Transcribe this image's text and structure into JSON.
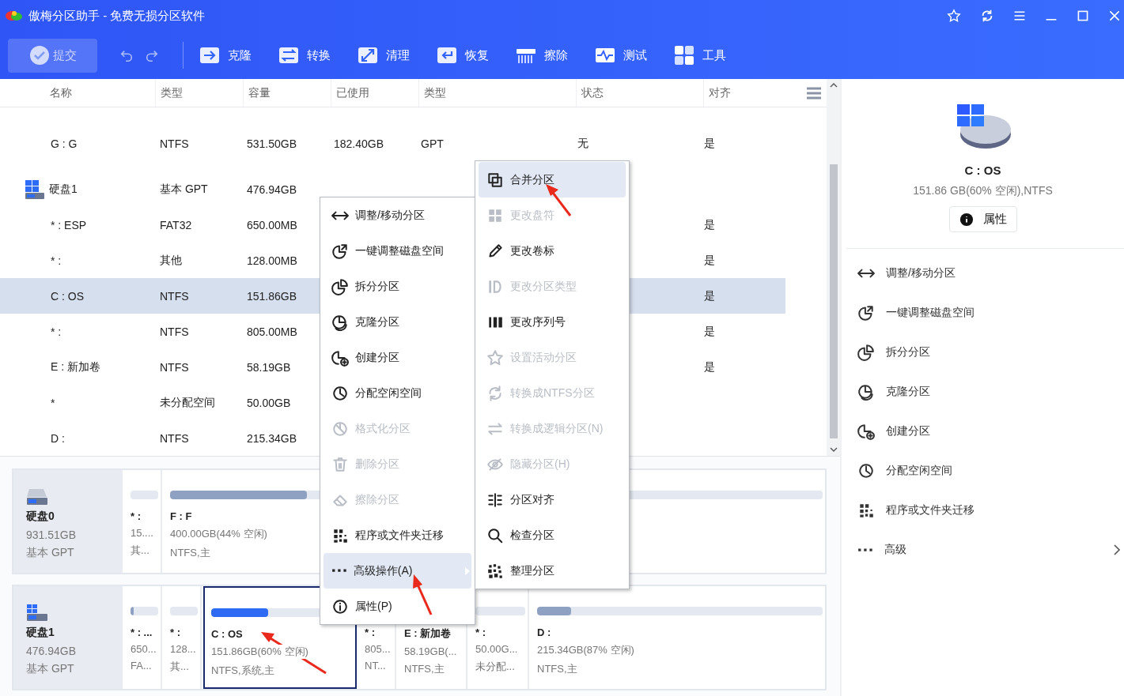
{
  "window": {
    "title": "傲梅分区助手 - 免费无损分区软件"
  },
  "toolbar": {
    "commit": {
      "label": "提交",
      "disabled": true
    },
    "tools": [
      {
        "label": "克隆"
      },
      {
        "label": "转换"
      },
      {
        "label": "清理"
      },
      {
        "label": "恢复"
      },
      {
        "label": "擦除"
      },
      {
        "label": "测试"
      },
      {
        "label": "工具"
      }
    ]
  },
  "table": {
    "columns": [
      "名称",
      "类型",
      "容量",
      "已使用",
      "类型",
      "状态",
      "对齐"
    ],
    "rows": [
      {
        "kind": "partition",
        "name": "G : G",
        "type": "NTFS",
        "capacity": "531.50GB",
        "used": "182.40GB",
        "part_type": "GPT",
        "status": "无",
        "aligned": "是",
        "selected": false
      },
      {
        "kind": "disk",
        "name": "硬盘1",
        "type": "基本 GPT",
        "capacity": "476.94GB",
        "selected": false
      },
      {
        "kind": "partition",
        "name": "* : ESP",
        "type": "FAT32",
        "capacity": "650.00MB",
        "aligned": "是",
        "selected": false
      },
      {
        "kind": "partition",
        "name": "* :",
        "type": "其他",
        "capacity": "128.00MB",
        "aligned": "是",
        "selected": false
      },
      {
        "kind": "partition",
        "name": "C : OS",
        "type": "NTFS",
        "capacity": "151.86GB",
        "aligned": "是",
        "selected": true
      },
      {
        "kind": "partition",
        "name": "* :",
        "type": "NTFS",
        "capacity": "805.00MB",
        "aligned": "是",
        "selected": false
      },
      {
        "kind": "partition",
        "name": "E : 新加卷",
        "type": "NTFS",
        "capacity": "58.19GB",
        "aligned": "是",
        "selected": false
      },
      {
        "kind": "partition",
        "name": "*",
        "type": "未分配空间",
        "capacity": "50.00GB",
        "selected": false
      },
      {
        "kind": "partition",
        "name": "D :",
        "type": "NTFS",
        "capacity": "215.34GB",
        "selected": false
      }
    ]
  },
  "disk_map": [
    {
      "name": "硬盘0",
      "size": "931.51GB",
      "style": "基本 GPT",
      "system": false,
      "partitions": [
        {
          "label": "* :",
          "size": "15....",
          "fs": "其...",
          "selected": false
        },
        {
          "label": "F : F",
          "size": "400.00GB(44% 空闲)",
          "fs": "NTFS,主",
          "level": 0.21,
          "selected": false
        }
      ]
    },
    {
      "name": "硬盘1",
      "size": "476.94GB",
      "style": "基本 GPT",
      "system": true,
      "partitions": [
        {
          "label": "* : ...",
          "size": "650...",
          "fs": "FA...",
          "level": 0.12,
          "selected": false
        },
        {
          "label": "* :",
          "size": "128...",
          "fs": "其...",
          "selected": false
        },
        {
          "label": "C : OS",
          "size": "151.86GB(60% 空闲)",
          "fs": "NTFS,系统,主",
          "level": 0.4,
          "selected": true
        },
        {
          "label": "* :",
          "size": "805...",
          "fs": "NT...",
          "selected": false
        },
        {
          "label": "E : 新加卷",
          "size": "58.19GB(...",
          "fs": "NTFS,主",
          "selected": false
        },
        {
          "label": "* :",
          "size": "50.00G...",
          "fs": "未分配...",
          "selected": false
        },
        {
          "label": "D :",
          "size": "215.34GB(87% 空闲)",
          "fs": "NTFS,主",
          "level": 0.12,
          "selected": false
        }
      ]
    }
  ],
  "context_menu": {
    "items": [
      {
        "label": "调整/移动分区",
        "disabled": false,
        "selected": false,
        "submenu": false
      },
      {
        "label": "一键调整磁盘空间",
        "disabled": false,
        "selected": false,
        "submenu": false
      },
      {
        "label": "拆分分区",
        "disabled": false,
        "selected": false,
        "submenu": false
      },
      {
        "label": "克隆分区",
        "disabled": false,
        "selected": false,
        "submenu": false
      },
      {
        "label": "创建分区",
        "disabled": false,
        "selected": false,
        "submenu": false
      },
      {
        "label": "分配空闲空间",
        "disabled": false,
        "selected": false,
        "submenu": false
      },
      {
        "label": "格式化分区",
        "disabled": true,
        "selected": false,
        "submenu": false
      },
      {
        "label": "删除分区",
        "disabled": true,
        "selected": false,
        "submenu": false
      },
      {
        "label": "擦除分区",
        "disabled": true,
        "selected": false,
        "submenu": false
      },
      {
        "label": "程序或文件夹迁移",
        "disabled": false,
        "selected": false,
        "submenu": false
      },
      {
        "label": "高级操作(A)",
        "disabled": false,
        "selected": true,
        "submenu": true
      },
      {
        "label": "属性(P)",
        "disabled": false,
        "selected": false,
        "submenu": false
      }
    ]
  },
  "submenu": {
    "items": [
      {
        "label": "合并分区",
        "disabled": false,
        "selected": true
      },
      {
        "label": "更改盘符",
        "disabled": true,
        "selected": false
      },
      {
        "label": "更改卷标",
        "disabled": false,
        "selected": false
      },
      {
        "label": "更改分区类型",
        "disabled": true,
        "selected": false
      },
      {
        "label": "更改序列号",
        "disabled": false,
        "selected": false
      },
      {
        "label": "设置活动分区",
        "disabled": true,
        "selected": false
      },
      {
        "label": "转换成NTFS分区",
        "disabled": true,
        "selected": false
      },
      {
        "label": "转换成逻辑分区(N)",
        "disabled": true,
        "selected": false
      },
      {
        "label": "隐藏分区(H)",
        "disabled": true,
        "selected": false
      },
      {
        "label": "分区对齐",
        "disabled": false,
        "selected": false
      },
      {
        "label": "检查分区",
        "disabled": false,
        "selected": false
      },
      {
        "label": "整理分区",
        "disabled": false,
        "selected": false
      }
    ]
  },
  "details": {
    "title": "C : OS",
    "info": "151.86 GB(60% 空闲),NTFS",
    "button": "属性",
    "actions": [
      {
        "label": "调整/移动分区",
        "submenu": false
      },
      {
        "label": "一键调整磁盘空间",
        "submenu": false
      },
      {
        "label": "拆分分区",
        "submenu": false
      },
      {
        "label": "克隆分区",
        "submenu": false
      },
      {
        "label": "创建分区",
        "submenu": false
      },
      {
        "label": "分配空闲空间",
        "submenu": false
      },
      {
        "label": "程序或文件夹迁移",
        "submenu": false
      },
      {
        "label": "高级",
        "submenu": true
      }
    ]
  }
}
